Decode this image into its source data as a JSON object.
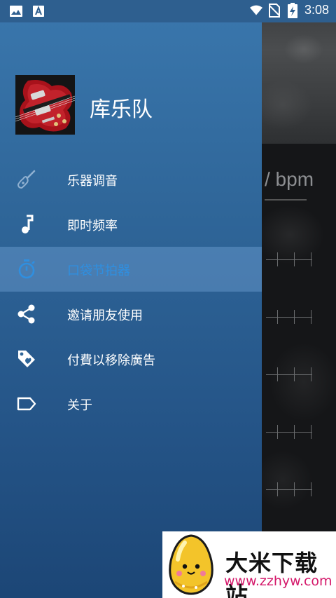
{
  "status_bar": {
    "time": "3:08",
    "icons": [
      "image-icon",
      "a-notification-icon",
      "wifi-icon",
      "no-sim-icon",
      "battery-charging-icon"
    ]
  },
  "drawer": {
    "app_name": "库乐队",
    "header_image": "guitar-photo",
    "items": [
      {
        "label": "乐器调音",
        "icon": "guitar-icon",
        "active": false
      },
      {
        "label": "即时频率",
        "icon": "music-note-icon",
        "active": false
      },
      {
        "label": "口袋节拍器",
        "icon": "stopwatch-icon",
        "active": true
      },
      {
        "label": "邀请朋友使用",
        "icon": "share-icon",
        "active": false
      },
      {
        "label": "付費以移除廣告",
        "icon": "tag-icon",
        "active": false
      },
      {
        "label": "关于",
        "icon": "label-icon",
        "active": false
      }
    ]
  },
  "background": {
    "bpm_label": "/ bpm"
  },
  "watermark": {
    "title": "大米下载站",
    "url": "www.zzhyw.com"
  },
  "colors": {
    "drawer_top": "#3a77ad",
    "drawer_bottom": "#1c4676",
    "active_text": "#2f8fe0",
    "status_bar": "#2e5f8f"
  }
}
